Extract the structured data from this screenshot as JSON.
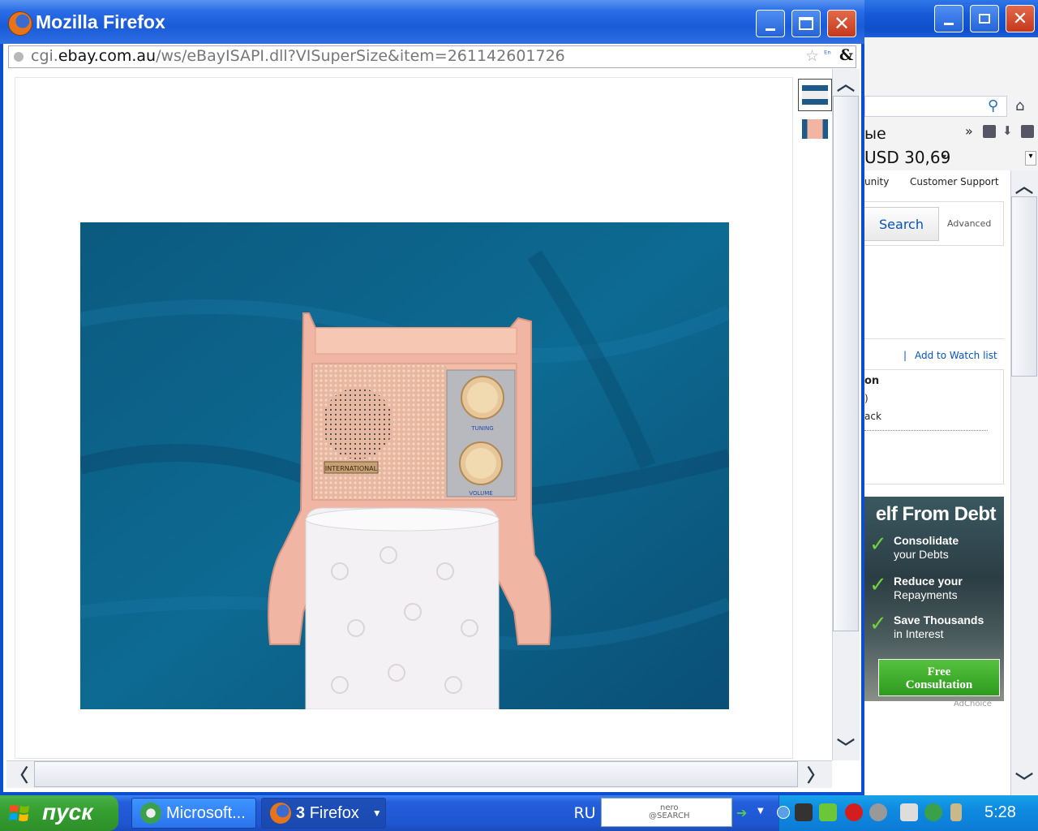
{
  "background_window": {
    "tab_fragment": "ые",
    "price": "USD 30,69",
    "nav_community": "unity",
    "nav_support": "Customer Support",
    "search_button": "Search",
    "advanced_link": "Advanced",
    "watch_separator": "|",
    "watch_link": "Add to Watch list",
    "seller_line1": "on",
    "seller_line2": ")",
    "seller_line3": "ack",
    "ad": {
      "headline": "elf From Debt",
      "item1_a": "Consolidate",
      "item1_b": "your Debts",
      "item2_a": "Reduce your",
      "item2_b": "Repayments",
      "item3_a": "Save Thousands",
      "item3_b": "in Interest",
      "button_line1": "Free",
      "button_line2": "Consultation",
      "adchoice": "AdChoice"
    }
  },
  "firefox_window": {
    "title": "Mozilla Firefox",
    "url_prefix": "cgi.",
    "url_domain": "ebay.com.au",
    "url_path": "/ws/eBayISAPI.dll?VISuperSize&item=261142601726",
    "photo": {
      "radio_brand": "INTERNATIONAL",
      "tuning_label": "TUNING",
      "volume_label": "VOLUME",
      "colors": {
        "blanket": "#0d5f86",
        "radio": "#f2b9a8",
        "paper": "#f4f2f4"
      }
    }
  },
  "taskbar": {
    "start_label": "пуск",
    "task1": "Microsoft...",
    "task2_count": "3",
    "task2_label": "Firefox",
    "language": "RU",
    "nero_line1": "nero",
    "nero_line2": "@SEARCH",
    "clock": "5:28"
  },
  "colors": {
    "xp_blue": "#245edb",
    "start_green": "#36a032",
    "link_blue": "#0654ba"
  }
}
